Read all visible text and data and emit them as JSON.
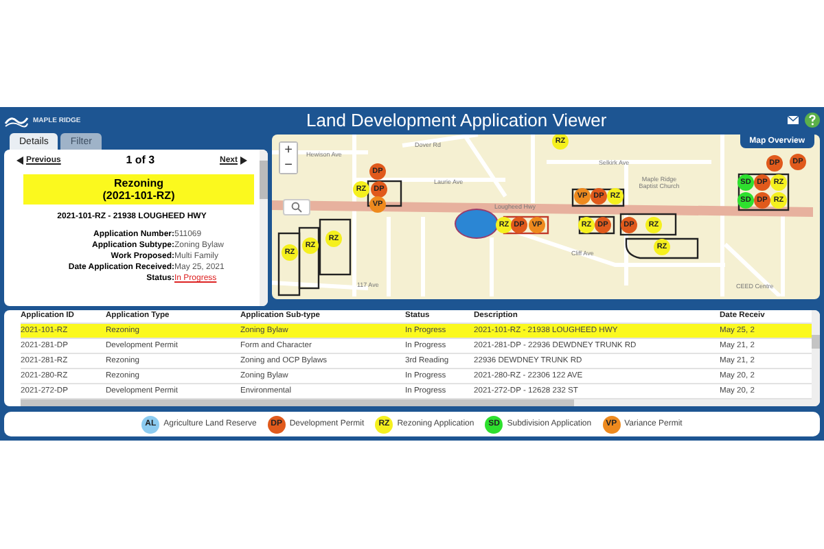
{
  "header": {
    "logo": "MAPLE RIDGE",
    "title": "Land Development Application Viewer"
  },
  "panel": {
    "tabs": [
      {
        "label": "Details",
        "selected": true
      },
      {
        "label": "Filter",
        "selected": false
      }
    ],
    "pager": {
      "previous": "Previous",
      "position": "1 of 3",
      "next": "Next"
    },
    "headline": [
      "Rezoning",
      "(2021-101-RZ)"
    ],
    "address": "2021-101-RZ - 21938 LOUGHEED HWY",
    "fields": [
      {
        "label": "Application Number:",
        "value": "511069",
        "kind": "text"
      },
      {
        "label": "Application Subtype:",
        "value": "Zoning Bylaw",
        "kind": "text"
      },
      {
        "label": "Work Proposed:",
        "value": "Multi Family",
        "kind": "text"
      },
      {
        "label": "Date Application Received:",
        "value": "May 25, 2021",
        "kind": "text"
      },
      {
        "label": "Status:",
        "value": "In Progress",
        "kind": "link"
      }
    ]
  },
  "map": {
    "overview_tab": "Map Overview",
    "zoom_in": "+",
    "zoom_out": "−",
    "street_labels": [
      "Hewison Ave",
      "Dover Rd",
      "Laurie Ave",
      "Selkirk Ave",
      "Maple Ridge Baptist Church",
      "Lougheed Hwy",
      "Cliff Ave",
      "117 Ave",
      "CEED Centre"
    ],
    "markers": [
      {
        "label": "RZ",
        "kind": "rezoning"
      },
      {
        "label": "DP",
        "kind": "development"
      },
      {
        "label": "RZ",
        "kind": "rezoning"
      },
      {
        "label": "DP",
        "kind": "development"
      },
      {
        "label": "VP",
        "kind": "variance"
      },
      {
        "label": "VP",
        "kind": "variance"
      },
      {
        "label": "DP",
        "kind": "development"
      },
      {
        "label": "RZ",
        "kind": "rezoning"
      },
      {
        "label": "RZ",
        "kind": "rezoning"
      },
      {
        "label": "DP",
        "kind": "development"
      },
      {
        "label": "VP",
        "kind": "variance"
      },
      {
        "label": "RZ",
        "kind": "rezoning"
      },
      {
        "label": "DP",
        "kind": "development"
      },
      {
        "label": "DP",
        "kind": "development"
      },
      {
        "label": "RZ",
        "kind": "rezoning"
      },
      {
        "label": "RZ",
        "kind": "rezoning"
      },
      {
        "label": "RZ",
        "kind": "rezoning"
      },
      {
        "label": "RZ",
        "kind": "rezoning"
      },
      {
        "label": "RZ",
        "kind": "rezoning"
      },
      {
        "label": "DP",
        "kind": "development"
      },
      {
        "label": "DP",
        "kind": "development"
      },
      {
        "label": "SD",
        "kind": "subdivision"
      },
      {
        "label": "DP",
        "kind": "development"
      },
      {
        "label": "RZ",
        "kind": "rezoning"
      },
      {
        "label": "SD",
        "kind": "subdivision"
      },
      {
        "label": "DP",
        "kind": "development"
      },
      {
        "label": "RZ",
        "kind": "rezoning"
      }
    ]
  },
  "table": {
    "columns": [
      "Application ID",
      "Application Type",
      "Application Sub-type",
      "Status",
      "Description",
      "Date Receiv"
    ],
    "rows": [
      {
        "cells": [
          "2021-101-RZ",
          "Rezoning",
          "Zoning Bylaw",
          "In Progress",
          "2021-101-RZ - 21938 LOUGHEED HWY",
          "May 25, 2"
        ],
        "selected": true
      },
      {
        "cells": [
          "2021-281-DP",
          "Development Permit",
          "Form and Character",
          "In Progress",
          "2021-281-DP - 22936 DEWDNEY TRUNK RD",
          "May 21, 2"
        ],
        "selected": false
      },
      {
        "cells": [
          "2021-281-RZ",
          "Rezoning",
          "Zoning and OCP Bylaws",
          "3rd Reading",
          "22936 DEWDNEY TRUNK RD",
          "May 21, 2"
        ],
        "selected": false
      },
      {
        "cells": [
          "2021-280-RZ",
          "Rezoning",
          "Zoning Bylaw",
          "In Progress",
          "2021-280-RZ - 22306 122 AVE",
          "May 20, 2"
        ],
        "selected": false
      },
      {
        "cells": [
          "2021-272-DP",
          "Development Permit",
          "Environmental",
          "In Progress",
          "2021-272-DP - 12628 232 ST",
          "May 20, 2"
        ],
        "selected": false
      }
    ]
  },
  "legend": [
    {
      "code": "AL",
      "label": "Agriculture Land Reserve",
      "color": "#8ccbf0"
    },
    {
      "code": "DP",
      "label": "Development Permit",
      "color": "#e05a1c"
    },
    {
      "code": "RZ",
      "label": "Rezoning Application",
      "color": "#f5f01e"
    },
    {
      "code": "SD",
      "label": "Subdivision Application",
      "color": "#2ee02e"
    },
    {
      "code": "VP",
      "label": "Variance Permit",
      "color": "#ee8a1e"
    }
  ]
}
